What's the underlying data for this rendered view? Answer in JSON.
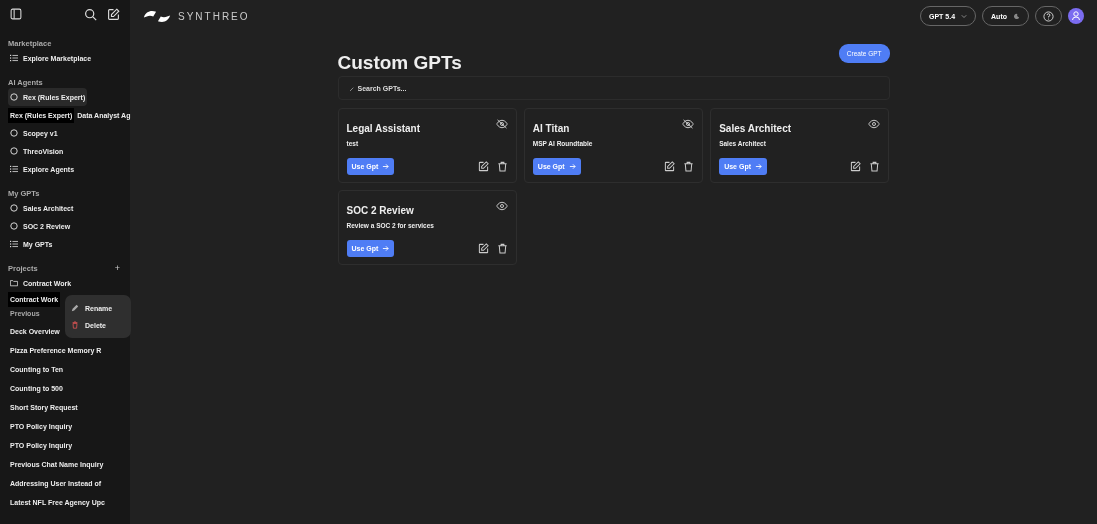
{
  "sidebar": {
    "sections": [
      {
        "title": "Marketplace",
        "items": [
          {
            "kind": "list",
            "label": "Explore Marketplace",
            "selected": false
          }
        ]
      },
      {
        "title": "AI Agents",
        "items": [
          {
            "kind": "agent",
            "label": "Rex (Rules Expert)",
            "selected": true
          },
          {
            "label": "Data Analyst Ag",
            "selected": false,
            "tooltip": "Rex (Rules Expert)"
          },
          {
            "kind": "agent",
            "label": "Scopey v1",
            "selected": false
          },
          {
            "kind": "agent",
            "label": "ThreoVision",
            "selected": false
          },
          {
            "kind": "list",
            "label": "Explore Agents",
            "selected": false
          }
        ]
      },
      {
        "title": "My GPTs",
        "items": [
          {
            "kind": "agent",
            "label": "Sales Architect",
            "selected": false
          },
          {
            "kind": "agent",
            "label": "SOC 2 Review",
            "selected": false
          },
          {
            "kind": "list",
            "label": "My GPTs",
            "selected": false
          }
        ]
      },
      {
        "title": "Projects",
        "add": "+",
        "items": [
          {
            "kind": "folder",
            "label": "Contract Work",
            "selected": false
          }
        ]
      }
    ],
    "tooltip": "Contract Work",
    "previous_title": "Previous",
    "chats": [
      "Deck Overview",
      "Pizza Preference Memory R",
      "Counting to Ten",
      "Counting to 500",
      "Short Story Request",
      "PTO Policy Inquiry",
      "PTO Policy Inquiry",
      "Previous Chat Name Inquiry",
      "Addressing User Instead of",
      "Latest NFL Free Agency Upc"
    ],
    "context_menu": [
      {
        "kind": "rename",
        "label": "Rename"
      },
      {
        "kind": "delete",
        "label": "Delete"
      }
    ]
  },
  "header": {
    "brand": "SYNTHREO",
    "model": "GPT 5.4",
    "theme": "Auto"
  },
  "page": {
    "title": "Custom GPTs",
    "create": "Create GPT",
    "search": {
      "placeholder": "Search GPTs..."
    },
    "cards": [
      {
        "title": "Legal Assistant",
        "description": "test",
        "visible": false,
        "button": "Use Gpt"
      },
      {
        "title": "AI Titan",
        "description": "MSP AI Roundtable",
        "visible": false,
        "button": "Use Gpt"
      },
      {
        "title": "Sales Architect",
        "description": "Sales Architect",
        "visible": true,
        "button": "Use Gpt"
      },
      {
        "title": "SOC 2 Review",
        "description": "Review a SOC 2 for services",
        "visible": true,
        "button": "Use Gpt"
      }
    ]
  }
}
